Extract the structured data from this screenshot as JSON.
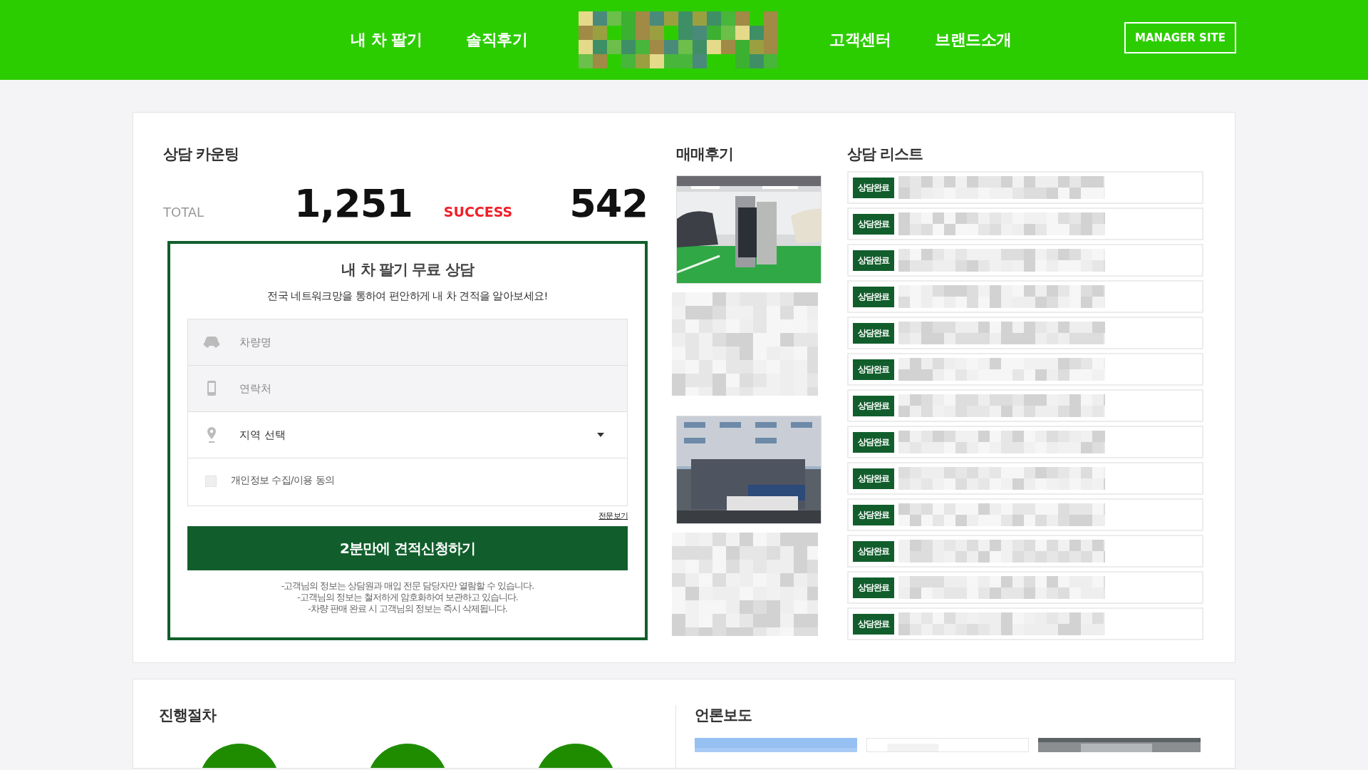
{
  "header": {
    "nav_left": [
      "내 차 팔기",
      "솔직후기"
    ],
    "nav_right": [
      "고객센터",
      "브랜드소개"
    ],
    "manager_button": "MANAGER SITE"
  },
  "counting": {
    "title": "상담 카운팅",
    "total_label": "TOTAL",
    "total": "1,251",
    "success_label": "SUCCESS",
    "success": "542"
  },
  "form": {
    "title": "내 차 팔기 무료 상담",
    "subtitle": "전국 네트워크망을 통하여 편안하게 내 차 견적을 알아보세요!",
    "fields": [
      {
        "kind": "text",
        "placeholder": "차량명"
      },
      {
        "kind": "tel",
        "placeholder": "연락처"
      },
      {
        "kind": "select",
        "value": "지역 선택"
      }
    ],
    "consent": {
      "label": "개인정보 수집/이용 동의",
      "checked": false,
      "link": "전문보기"
    },
    "submit": "2분만에 견적신청하기",
    "notes": [
      "-고객님의 정보는 상담원과 매입 전문 담당자만 열람할 수 있습니다.",
      "-고객님의 정보는 철저하게 암호화하여 보관하고 있습니다.",
      "-차량 판매 완료 시 고객님의 정보는 즉시 삭제됩니다."
    ]
  },
  "reviews": {
    "title": "매매후기"
  },
  "consult_list": {
    "title": "상담 리스트",
    "items": [
      {
        "status": "상담완료"
      },
      {
        "status": "상담완료"
      },
      {
        "status": "상담완료"
      },
      {
        "status": "상담완료"
      },
      {
        "status": "상담완료"
      },
      {
        "status": "상담완료"
      },
      {
        "status": "상담완료"
      },
      {
        "status": "상담완료"
      },
      {
        "status": "상담완료"
      },
      {
        "status": "상담완료"
      },
      {
        "status": "상담완료"
      },
      {
        "status": "상담완료"
      },
      {
        "status": "상담완료"
      }
    ]
  },
  "process": {
    "title": "진행절차"
  },
  "press": {
    "title": "언론보도"
  }
}
